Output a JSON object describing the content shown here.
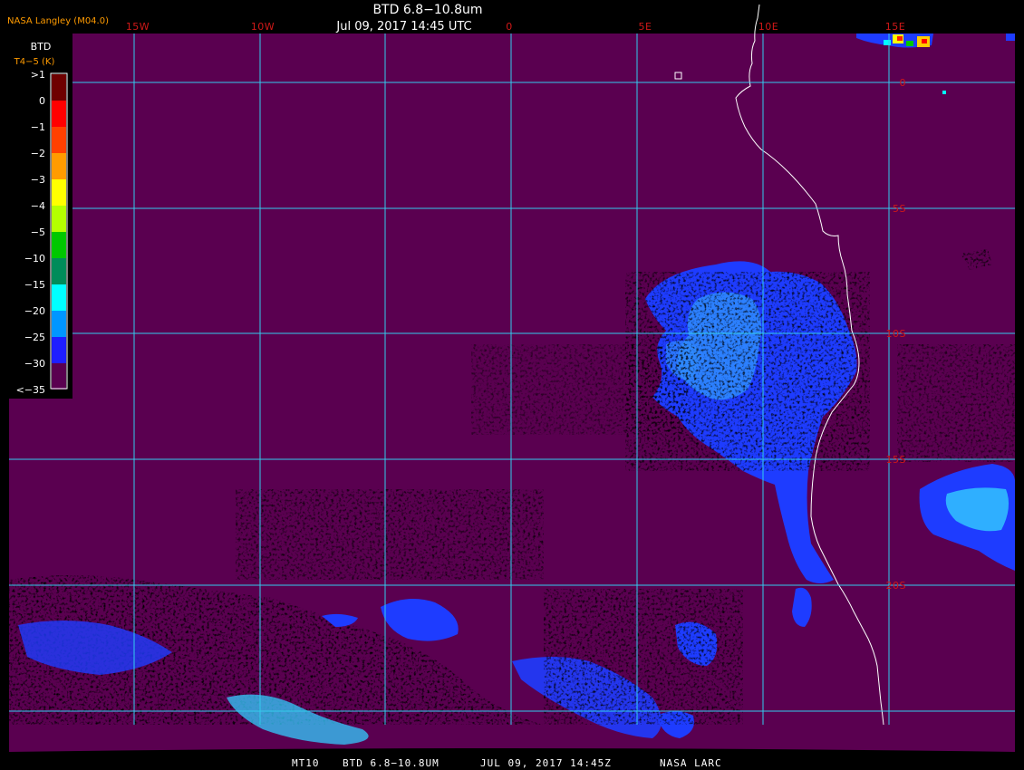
{
  "header": {
    "product_title": "BTD 6.8−10.8um",
    "datetime": "Jul 09, 2017 14:45 UTC",
    "credit": "NASA Langley (M04.0)"
  },
  "footer": {
    "satellite": "MT10",
    "product": "BTD 6.8−10.8UM",
    "date": "JUL 09, 2017 14:45Z",
    "source": "NASA LARC"
  },
  "map": {
    "background_color": "#5a0050",
    "grid_color": "#33ccee",
    "coastline_color": "#ffffff",
    "longitude_labels": [
      "15W",
      "10W",
      "0",
      "5E",
      "10E",
      "15E"
    ],
    "latitude_labels": [
      "0",
      "5S",
      "10S",
      "15S",
      "20S"
    ]
  },
  "legend": {
    "title": "BTD",
    "unit": "T4−5 (K)",
    "labels": [
      ">1",
      "0",
      "−1",
      "−2",
      "−3",
      "−4",
      "−5",
      "−10",
      "−15",
      "−20",
      "−25",
      "−30",
      "<−35"
    ],
    "colors": [
      "#6e0000",
      "#ff0000",
      "#ff4000",
      "#ff9b00",
      "#ffff00",
      "#b4ff00",
      "#00c800",
      "#008c5a",
      "#00ffff",
      "#0096ff",
      "#1e1eff",
      "#5a0050"
    ]
  }
}
